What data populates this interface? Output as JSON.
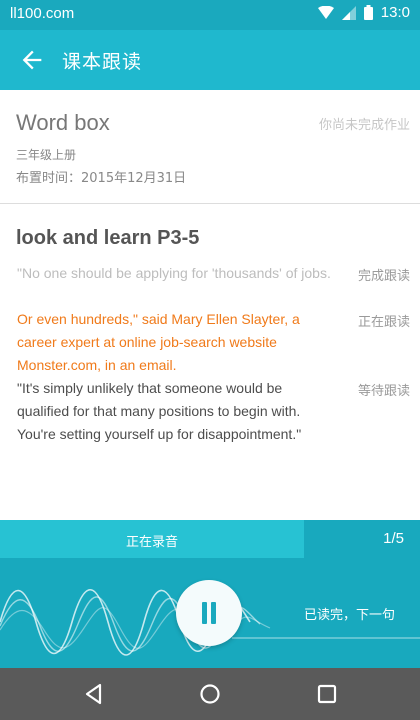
{
  "status_bar": {
    "site": "ll100.com",
    "time": "13:0"
  },
  "app_bar": {
    "title": "课本跟读",
    "back_icon": "arrow-left-icon"
  },
  "info": {
    "word_title": "Word box",
    "homework_status": "你尚未完成作业",
    "grade": "三年级上册",
    "due": "布置时间：2015年12月31日"
  },
  "lesson": {
    "heading": "look and learn P3-5",
    "sentences": [
      {
        "text": "\"No one should be applying for 'thousands' of jobs.",
        "state": "完成跟读"
      },
      {
        "text": "Or even hundreds,\" said Mary Ellen Slayter, a career expert at online job-search website Monster.com, in an email.",
        "state": "正在跟读"
      },
      {
        "text": "\"It's simply unlikely that someone would be qualified for that many positions to begin with. You're setting yourself up for disappointment.\"",
        "state": "等待跟读"
      }
    ]
  },
  "recorder": {
    "recording_label": "正在录音",
    "progress": "1/5",
    "next_label": "已读完，下一句",
    "pause_icon": "pause-icon"
  },
  "colors": {
    "primary": "#1fb8ce",
    "status_bar": "#1aa9be",
    "recording_bar": "#27c2d3",
    "active_sentence": "#f07a1a",
    "nav_bar": "#5a5a5a"
  }
}
